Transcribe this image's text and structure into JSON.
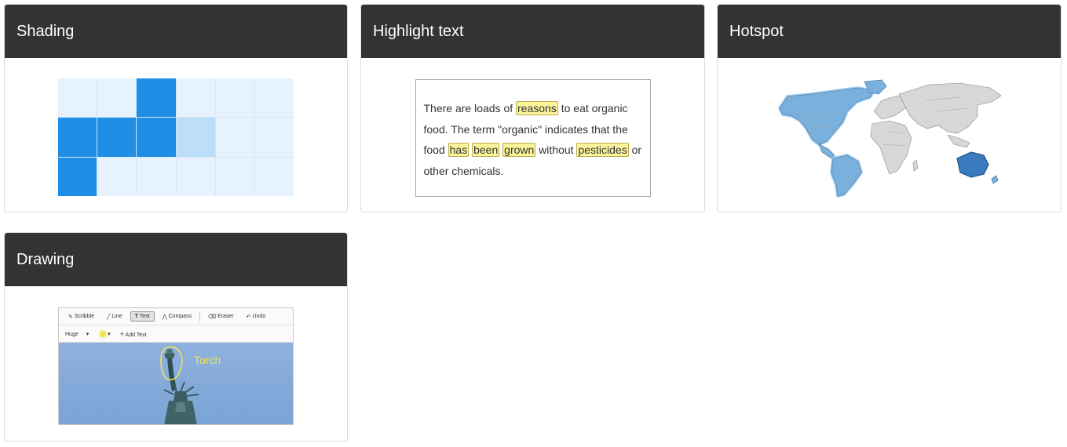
{
  "cards": {
    "shading": {
      "title": "Shading",
      "grid": [
        [
          "empty",
          "empty",
          "dark",
          "empty",
          "empty",
          "empty"
        ],
        [
          "dark",
          "dark",
          "dark",
          "light",
          "empty",
          "empty"
        ],
        [
          "dark",
          "empty",
          "empty",
          "empty",
          "empty",
          "empty"
        ]
      ]
    },
    "highlight": {
      "title": "Highlight text",
      "lines": [
        [
          {
            "t": "There are loads of "
          },
          {
            "t": "reasons",
            "h": true
          },
          {
            "t": " to eat organic"
          }
        ],
        [
          {
            "t": "food. The term \"organic\" indicates that the"
          }
        ],
        [
          {
            "t": "food "
          },
          {
            "t": "has",
            "h": true
          },
          {
            "t": " "
          },
          {
            "t": "been",
            "h": true
          },
          {
            "t": " "
          },
          {
            "t": "grown",
            "h": true
          },
          {
            "t": " without "
          },
          {
            "t": "pesticides",
            "h": true
          },
          {
            "t": " or"
          }
        ],
        [
          {
            "t": "other chemicals."
          }
        ]
      ]
    },
    "hotspot": {
      "title": "Hotspot"
    },
    "drawing": {
      "title": "Drawing",
      "toolbar": {
        "scribble": "Scribble",
        "line": "Line",
        "text": "Text",
        "compass": "Compass",
        "eraser": "Eraser",
        "undo": "Undo",
        "size": "Huge",
        "add_text": "Add Text"
      },
      "canvas_label": "Torch"
    }
  },
  "colors": {
    "header_bg": "#333333",
    "shade_dark": "#1e8ee6",
    "shade_light": "#bcdef8",
    "highlight": "#fbf49a",
    "map_selected": "#7ab0dc",
    "map_default": "#d7d7d7"
  }
}
